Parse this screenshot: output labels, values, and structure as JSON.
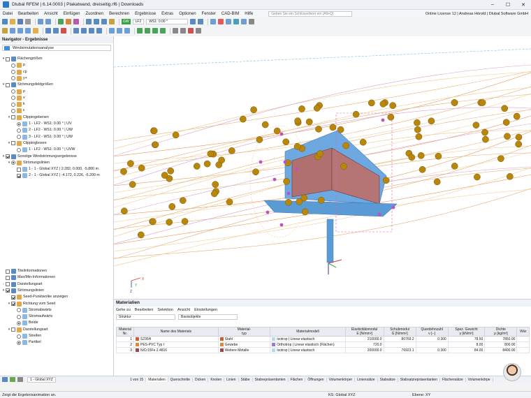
{
  "window": {
    "title": "Dlubal RFEM | 6.14.0003 | Plakatwand, dreiseitig.rf6 | Downloads",
    "controls": [
      "–",
      "☐",
      "✕"
    ]
  },
  "menu": {
    "items": [
      "Datei",
      "Bearbeiten",
      "Ansicht",
      "Einfügen",
      "Zuordnen",
      "Berechnen",
      "Ergebnisse",
      "Extras",
      "Optionen",
      "Fenster",
      "CAD-BIM",
      "Hilfe"
    ],
    "search_placeholder": "Geben Sie ein Schlüsselwort ein (Alt+Q)",
    "license": "Online License 12 | Andreas Hörold | Dlubal Software GmbH"
  },
  "toolbar": {
    "lc_badge": "GW",
    "lc_name": "LF2",
    "lc_desc": "WS1: 0.00 °"
  },
  "navigator": {
    "title": "Navigator - Ergebnisse",
    "selector": "Windsimulationsanalyse",
    "tree": [
      {
        "label": "Flächengrößen",
        "level": 0,
        "ctrl": "cb",
        "on": false,
        "twist": "▾"
      },
      {
        "label": "p",
        "level": 1,
        "ctrl": "rd",
        "on": false
      },
      {
        "label": "cp",
        "level": 1,
        "ctrl": "rd",
        "on": false
      },
      {
        "label": "y+",
        "level": 1,
        "ctrl": "rd",
        "on": false
      },
      {
        "label": "Strömungsfeldgrößen",
        "level": 0,
        "ctrl": "cb",
        "on": false,
        "twist": "▾"
      },
      {
        "label": "p",
        "level": 1,
        "ctrl": "rd",
        "on": false
      },
      {
        "label": "v",
        "level": 1,
        "ctrl": "rd",
        "on": false
      },
      {
        "label": "k",
        "level": 1,
        "ctrl": "rd",
        "on": false
      },
      {
        "label": "ε",
        "level": 1,
        "ctrl": "rd",
        "on": false
      },
      {
        "label": "Clippingebenen",
        "level": 1,
        "ctrl": "cb",
        "on": false,
        "twist": "▾"
      },
      {
        "label": "1 - LF2 - WS1: 0.00 ° | UV",
        "level": 2,
        "ctrl": "rd",
        "on": true
      },
      {
        "label": "2 - LF2 - WS1: 0.00 ° | UW",
        "level": 2,
        "ctrl": "rd",
        "on": false
      },
      {
        "label": "3 - LF2 - WS1: 0.00 ° | UW",
        "level": 2,
        "ctrl": "rd",
        "on": false
      },
      {
        "label": "Clippingboxen",
        "level": 1,
        "ctrl": "cb",
        "on": false,
        "twist": "▾"
      },
      {
        "label": "1 - LF2 - WS1: 0.00 ° | UVW",
        "level": 2,
        "ctrl": "rd",
        "on": false
      },
      {
        "label": "Sonstige Windströmungsergebnisse",
        "level": 0,
        "ctrl": "cb",
        "on": true,
        "twist": "▾"
      },
      {
        "label": "Strömungslinien",
        "level": 1,
        "ctrl": "rd",
        "on": true,
        "twist": "▾"
      },
      {
        "label": "1 - 1 - Global XYZ | 2.282, 0.000, -5.800 m",
        "level": 2,
        "ctrl": "cb",
        "on": false
      },
      {
        "label": "2 - 1 - Global XYZ | -4.172, 0.226, -6.200 m",
        "level": 2,
        "ctrl": "cb",
        "on": true
      }
    ],
    "tree2": [
      {
        "label": "Titelinformationen",
        "level": 0,
        "ctrl": "cb",
        "on": false
      },
      {
        "label": "Max/Min-Informationen",
        "level": 0,
        "ctrl": "cb",
        "on": false
      },
      {
        "label": "Darstellungsart",
        "level": 0,
        "ctrl": "cb",
        "on": false,
        "twist": "›"
      },
      {
        "label": "Strömungslinien",
        "level": 0,
        "ctrl": "cb",
        "on": true,
        "twist": "▾"
      },
      {
        "label": "Seed-Punktwolke anzeigen",
        "level": 1,
        "ctrl": "cb",
        "on": true
      },
      {
        "label": "Richtung vom Seed",
        "level": 1,
        "ctrl": "cb",
        "on": true,
        "twist": "▾"
      },
      {
        "label": "Stromabwärts",
        "level": 2,
        "ctrl": "rd",
        "on": false
      },
      {
        "label": "Stromaufwärts",
        "level": 2,
        "ctrl": "rd",
        "on": false
      },
      {
        "label": "Beide",
        "level": 2,
        "ctrl": "rd",
        "on": true
      },
      {
        "label": "Darstellungsart",
        "level": 1,
        "ctrl": "cb",
        "on": false,
        "twist": "▾"
      },
      {
        "label": "Streifen",
        "level": 2,
        "ctrl": "rd",
        "on": false
      },
      {
        "label": "Partikel",
        "level": 2,
        "ctrl": "rd",
        "on": true
      }
    ]
  },
  "axes": {
    "x": "X",
    "y": "Y",
    "z": "Z"
  },
  "results": {
    "title": "Materialien",
    "menu": [
      "Gehe zu",
      "Bearbeiten",
      "Selektion",
      "Ansicht",
      "Einstellungen"
    ],
    "filter": "Struktur",
    "filter2": "Basisobjekte",
    "headers": [
      [
        "Material\nNr.",
        "Name des Materials",
        "Material-\ntyp",
        "Materialmodell",
        "Elastizitätsmodul\nE [N/mm²]",
        "Schubmodul\nG [N/mm²]",
        "Querdehnzahl\nν [--]",
        "Spez. Gewicht\nγ [kN/m³]",
        "Dichte\nρ [kg/m³]",
        "Wär"
      ]
    ],
    "rows": [
      {
        "no": "1",
        "name": "S235H",
        "type": "Stahl",
        "type_color": "#c8622c",
        "model": "Isotrop | Linear elastisch",
        "model_color": "#b8d8f0",
        "e": "210000.0",
        "g": "80769.2",
        "nu": "0.300",
        "gamma": "78.50",
        "rho": "7850.00"
      },
      {
        "no": "2",
        "name": "PES-PVC Typ I",
        "type": "Gewebe",
        "type_color": "#d88a3a",
        "model": "Orthotrop | Linear elastisch (Flächen)",
        "model_color": "#9a7ad6",
        "e": "720.0",
        "g": "",
        "nu": "",
        "gamma": "8.00",
        "rho": "800.00"
      },
      {
        "no": "3",
        "name": "NiCr15Fe 2.4816",
        "type": "Weitere Metalle",
        "type_color": "#a04848",
        "model": "Isotrop | Linear elastisch",
        "model_color": "#b8d8f0",
        "e": "200000.0",
        "g": "76923.1",
        "nu": "0.300",
        "gamma": "84.00",
        "rho": "8400.00"
      }
    ],
    "pager": "1 von 15",
    "tabs": [
      "Materialien",
      "Querschnitte",
      "Dicken",
      "Knoten",
      "Linien",
      "Stäbe",
      "Stabrepräsentanten",
      "Flächen",
      "Öffnungen",
      "Volumenkörper",
      "Liniensätze",
      "Stabsätze",
      "Stabsatzrepräsentanten",
      "Flächensätze",
      "Volumenkörpe"
    ]
  },
  "navbottom": {
    "cs": "1 - Global XYZ"
  },
  "status": {
    "left": "Zeigt die Ergebnisanimation an.",
    "cs": "KS: Global XYZ",
    "plane": "Ebene: XY"
  }
}
